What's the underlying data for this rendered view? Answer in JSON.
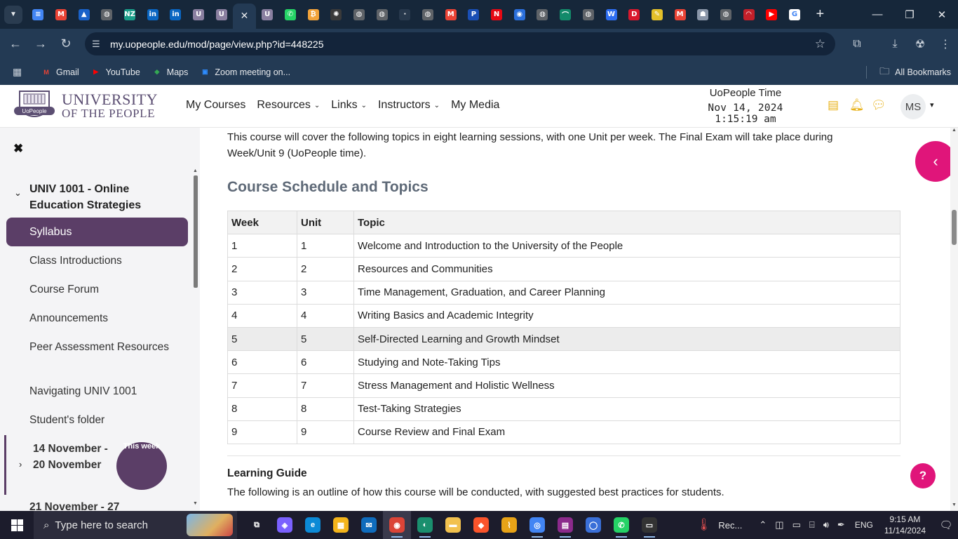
{
  "browser": {
    "tabs": [
      {
        "icon": "google-docs-icon",
        "glyph": "≡",
        "bg": "#4285f4"
      },
      {
        "icon": "gmail-icon",
        "glyph": "M",
        "bg": "#ea4335"
      },
      {
        "icon": "blue-arrow-icon",
        "glyph": "▲",
        "bg": "#1a62c9"
      },
      {
        "icon": "globe-icon",
        "glyph": "◍",
        "bg": "#5f6368"
      },
      {
        "icon": "nz-icon",
        "glyph": "NZ",
        "bg": "#1a9e8a"
      },
      {
        "icon": "linkedin-icon",
        "glyph": "in",
        "bg": "#0a66c2"
      },
      {
        "icon": "linkedin-icon",
        "glyph": "in",
        "bg": "#0a66c2"
      },
      {
        "icon": "uopeople-icon",
        "glyph": "U",
        "bg": "#8a7fa0"
      },
      {
        "icon": "uopeople-icon",
        "glyph": "U",
        "bg": "#8a7fa0"
      },
      {
        "icon": "close-icon",
        "glyph": "✕",
        "bg": "transparent",
        "active": true
      },
      {
        "icon": "uopeople-icon",
        "glyph": "U",
        "bg": "#8a7fa0"
      },
      {
        "icon": "whatsapp-icon",
        "glyph": "✆",
        "bg": "#25d366"
      },
      {
        "icon": "coin-icon",
        "glyph": "₿",
        "bg": "#f2a33a"
      },
      {
        "icon": "openai-icon",
        "glyph": "✺",
        "bg": "#3a3a3a"
      },
      {
        "icon": "globe-icon",
        "glyph": "◍",
        "bg": "#5f6368"
      },
      {
        "icon": "globe-icon",
        "glyph": "◍",
        "bg": "#5f6368"
      },
      {
        "icon": "blank-icon",
        "glyph": "·",
        "bg": "#27384c"
      },
      {
        "icon": "globe-icon",
        "glyph": "◍",
        "bg": "#5f6368"
      },
      {
        "icon": "gmail-icon",
        "glyph": "M",
        "bg": "#ea4335"
      },
      {
        "icon": "paypal-icon",
        "glyph": "P",
        "bg": "#1a4fb5"
      },
      {
        "icon": "netflix-icon",
        "glyph": "N",
        "bg": "#e50914"
      },
      {
        "icon": "google-earth-icon",
        "glyph": "◉",
        "bg": "#2a6fdc"
      },
      {
        "icon": "globe-icon",
        "glyph": "◍",
        "bg": "#5f6368"
      },
      {
        "icon": "green-arc-icon",
        "glyph": "⌒",
        "bg": "#138a6a"
      },
      {
        "icon": "globe-icon",
        "glyph": "◍",
        "bg": "#5f6368"
      },
      {
        "icon": "webflow-icon",
        "glyph": "W",
        "bg": "#2e6ef2"
      },
      {
        "icon": "d-icon",
        "glyph": "D",
        "bg": "#d9182d"
      },
      {
        "icon": "yellow-app-icon",
        "glyph": "✎",
        "bg": "#e3c02a"
      },
      {
        "icon": "gmail-icon",
        "glyph": "M",
        "bg": "#ea4335"
      },
      {
        "icon": "ghost-icon",
        "glyph": "☗",
        "bg": "#8a96a8"
      },
      {
        "icon": "globe-icon",
        "glyph": "◍",
        "bg": "#5f6368"
      },
      {
        "icon": "red-gauge-icon",
        "glyph": "◠",
        "bg": "#c4202a"
      },
      {
        "icon": "youtube-icon",
        "glyph": "▶",
        "bg": "#ff0000"
      },
      {
        "icon": "google-icon",
        "glyph": "G",
        "bg": "#ffffff"
      }
    ],
    "url": "my.uopeople.edu/mod/page/view.php?id=448225",
    "bookmarks": [
      {
        "label": "Gmail",
        "icon": "gmail-icon",
        "glyph": "M",
        "color": "#ea4335"
      },
      {
        "label": "YouTube",
        "icon": "youtube-icon",
        "glyph": "▶",
        "color": "#ff0000"
      },
      {
        "label": "Maps",
        "icon": "maps-icon",
        "glyph": "◆",
        "color": "#34a853"
      },
      {
        "label": "Zoom meeting on...",
        "icon": "zoom-icon",
        "glyph": "▣",
        "color": "#2d8cff"
      }
    ],
    "all_bookmarks": "All Bookmarks"
  },
  "site": {
    "logo_line1": "UNIVERSITY",
    "logo_line2": "OF THE PEOPLE",
    "logo_badge": "UoPeople",
    "nav": [
      {
        "label": "My Courses",
        "dropdown": false
      },
      {
        "label": "Resources",
        "dropdown": true
      },
      {
        "label": "Links",
        "dropdown": true
      },
      {
        "label": "Instructors",
        "dropdown": true
      },
      {
        "label": "My Media",
        "dropdown": false
      }
    ],
    "time_title": "UoPeople Time",
    "time_date": "Nov 14, 2024",
    "time_clock": "1:15:19 am",
    "avatar_initials": "MS"
  },
  "drawer": {
    "course_title": "UNIV 1001 - Online Education Strategies",
    "active_item": "Syllabus",
    "items": [
      "Class Introductions",
      "Course Forum",
      "Announcements",
      "Peer Assessment Resources",
      "Navigating UNIV 1001",
      "Student's folder"
    ],
    "week_label": "14 November - 20 November",
    "week_badge": "This week",
    "next_week": "21 November - 27"
  },
  "content": {
    "intro": "This course will cover the following topics in eight learning sessions, with one Unit per week. The Final Exam will take place during Week/Unit 9 (UoPeople time).",
    "schedule_heading": "Course Schedule and Topics",
    "table_headers": [
      "Week",
      "Unit",
      "Topic"
    ],
    "rows": [
      [
        "1",
        "1",
        "Welcome and Introduction to the University of the People"
      ],
      [
        "2",
        "2",
        "Resources and Communities"
      ],
      [
        "3",
        "3",
        "Time Management, Graduation, and Career Planning"
      ],
      [
        "4",
        "4",
        "Writing Basics and Academic Integrity"
      ],
      [
        "5",
        "5",
        "Self-Directed Learning and Growth Mindset"
      ],
      [
        "6",
        "6",
        "Studying and Note-Taking Tips"
      ],
      [
        "7",
        "7",
        "Stress Management and Holistic Wellness"
      ],
      [
        "8",
        "8",
        "Test-Taking Strategies"
      ],
      [
        "9",
        "9",
        "Course Review and Final Exam"
      ]
    ],
    "highlighted_row": 4,
    "learning_guide_heading": "Learning Guide",
    "learning_guide_text": "The following is an outline of how this course will be conducted, with suggested best practices for students."
  },
  "taskbar": {
    "search_placeholder": "Type here to search",
    "apps": [
      {
        "icon": "task-view-icon",
        "glyph": "⧉",
        "bg": "transparent"
      },
      {
        "icon": "copilot-icon",
        "glyph": "◈",
        "bg": "#7b61ff"
      },
      {
        "icon": "edge-icon",
        "glyph": "e",
        "bg": "#0c8ad6"
      },
      {
        "icon": "store-icon",
        "glyph": "▦",
        "bg": "#f3b41b"
      },
      {
        "icon": "mail-icon",
        "glyph": "✉",
        "bg": "#0f6cbd"
      },
      {
        "icon": "chrome-icon",
        "glyph": "◉",
        "bg": "#db4437",
        "running": true,
        "active": true
      },
      {
        "icon": "vpn-icon",
        "glyph": "◐",
        "bg": "#1a8f6e",
        "running": true
      },
      {
        "icon": "file-explorer-icon",
        "glyph": "▬",
        "bg": "#f2c14e"
      },
      {
        "icon": "brave-icon",
        "glyph": "◆",
        "bg": "#fb542b"
      },
      {
        "icon": "ai-app-icon",
        "glyph": "⌇",
        "bg": "#e8a317"
      },
      {
        "icon": "chrome-icon",
        "glyph": "◎",
        "bg": "#4285f4",
        "running": true
      },
      {
        "icon": "winrar-icon",
        "glyph": "▤",
        "bg": "#8c2a8c",
        "running": true
      },
      {
        "icon": "blue-app-icon",
        "glyph": "◯",
        "bg": "#3a6fd8"
      },
      {
        "icon": "whatsapp-icon",
        "glyph": "✆",
        "bg": "#25d366",
        "running": true
      },
      {
        "icon": "terminal-icon",
        "glyph": "▭",
        "bg": "#333333",
        "running": true
      }
    ],
    "weather_label": "Rec...",
    "language": "ENG",
    "time": "9:15 AM",
    "date": "11/14/2024"
  }
}
